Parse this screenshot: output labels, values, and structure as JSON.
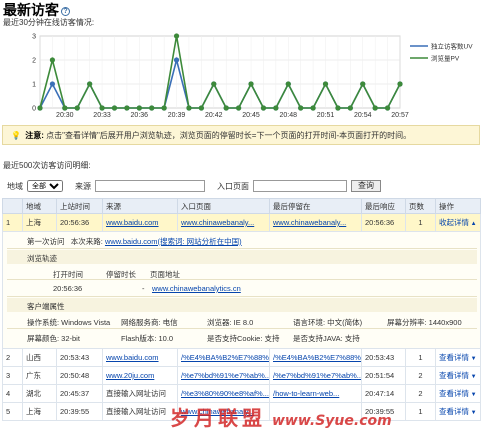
{
  "header": {
    "title": "最新访客",
    "help_icon": "?",
    "subtitle": "最近30分钟在线访客情况:"
  },
  "chart_data": {
    "type": "line",
    "x": [
      "20:28",
      "20:29",
      "20:30",
      "20:31",
      "20:32",
      "20:33",
      "20:34",
      "20:35",
      "20:36",
      "20:37",
      "20:38",
      "20:39",
      "20:40",
      "20:41",
      "20:42",
      "20:43",
      "20:44",
      "20:45",
      "20:46",
      "20:47",
      "20:48",
      "20:49",
      "20:50",
      "20:51",
      "20:52",
      "20:53",
      "20:54",
      "20:55",
      "20:56",
      "20:57"
    ],
    "xticks": [
      "20:30",
      "20:33",
      "20:36",
      "20:39",
      "20:42",
      "20:45",
      "20:48",
      "20:51",
      "20:54",
      "20:57"
    ],
    "yticks": [
      "0",
      "1",
      "2",
      "3"
    ],
    "ylim": [
      0,
      3
    ],
    "series": [
      {
        "name": "独立访客数UV",
        "color": "#3a6fb7",
        "values": [
          0,
          1,
          0,
          0,
          1,
          0,
          0,
          0,
          0,
          0,
          0,
          2,
          0,
          0,
          1,
          0,
          0,
          1,
          0,
          0,
          1,
          0,
          0,
          1,
          0,
          0,
          1,
          0,
          0,
          1
        ]
      },
      {
        "name": "浏览量PV",
        "color": "#3d8a3a",
        "values": [
          0,
          2,
          0,
          0,
          1,
          0,
          0,
          0,
          0,
          0,
          0,
          3,
          0,
          0,
          1,
          0,
          0,
          1,
          0,
          0,
          1,
          0,
          0,
          1,
          0,
          0,
          1,
          0,
          0,
          1
        ]
      }
    ]
  },
  "notice": {
    "icon": "bulb-icon",
    "label": "注意:",
    "text": "点击\"查看详情\"后展开用户浏览轨迹，浏览页面的停留时长=下一个页面的打开时间-本页面打开的时间。"
  },
  "recent_label": "最近500次访客访问明细:",
  "filter": {
    "region_label": "地域",
    "region_value": "全部",
    "source_label": "来源",
    "source_value": "",
    "entry_label": "入口页面",
    "entry_value": "",
    "search_button": "查询"
  },
  "table": {
    "headers": [
      "地域",
      "上站时间",
      "来源",
      "入口页面",
      "最后停留在",
      "最后响应",
      "页数",
      "操作"
    ],
    "rows": [
      {
        "idx": "1",
        "region": "上海",
        "time": "20:56:36",
        "source": "www.baidu.com",
        "entry": "www.chinawebanaly...",
        "last": "www.chinawebanaly...",
        "resp": "20:56:36",
        "pages": "1",
        "action": "收起详情"
      },
      {
        "idx": "2",
        "region": "山西",
        "time": "20:53:43",
        "source": "www.baidu.com",
        "entry": "/%E4%BA%B2%E7%88%...",
        "last": "/%E4%BA%B2%E7%88%...",
        "resp": "20:53:43",
        "pages": "1",
        "action": "查看详情"
      },
      {
        "idx": "3",
        "region": "广东",
        "time": "20:50:48",
        "source": "www.20ju.com",
        "entry": "/%e7%bd%91%e7%ab%...",
        "last": "/%e7%bd%91%e7%ab%...",
        "resp": "20:51:54",
        "pages": "2",
        "action": "查看详情"
      },
      {
        "idx": "4",
        "region": "湖北",
        "time": "20:45:37",
        "source": "直接输入网址访问",
        "entry": "/%e3%80%90%e8%af%...",
        "last": "/how-to-learn-web...",
        "resp": "20:47:14",
        "pages": "2",
        "action": "查看详情"
      },
      {
        "idx": "5",
        "region": "上海",
        "time": "20:39:55",
        "source": "直接输入网址访问",
        "entry": "www.chinawebanaly...",
        "last": "",
        "resp": "20:39:55",
        "pages": "1",
        "action": "查看详情"
      }
    ]
  },
  "detail": {
    "first_visit_label": "第一次访问",
    "this_visit_label": "本次来路:",
    "this_visit_link": "www.baidu.com(搜索词: 网站分析在中国)",
    "trail_label": "浏览轨迹",
    "trail_headers": [
      "打开时间",
      "停留时长",
      "页面地址"
    ],
    "trail_row": {
      "open": "20:56:36",
      "stay": "-",
      "url": "www.chinawebanalytics.cn"
    },
    "client_label": "客户端属性",
    "os": "操作系统: Windows Vista",
    "isp": "网络服务商: 电信",
    "browser": "浏览器: IE 8.0",
    "lang": "语言环境: 中文(简体)",
    "resolution": "屏幕分辨率: 1440x900",
    "color": "屏幕颜色: 32-bit",
    "flash": "Flash版本: 10.0",
    "cookie": "是否支持Cookie: 支持",
    "java": "是否支持JAVA: 支持"
  },
  "watermark": {
    "text": "岁月联盟",
    "url": "www.Syue.com"
  }
}
